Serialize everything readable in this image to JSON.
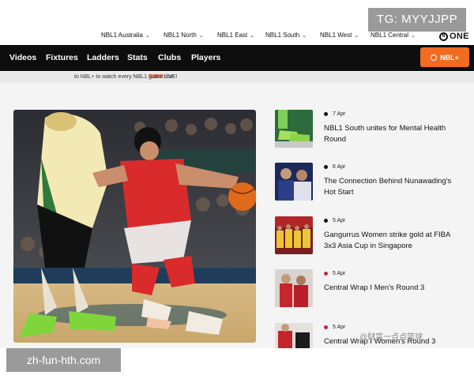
{
  "watermarks": {
    "top": "TG: MYYJJPP",
    "bottom": "zh-fun-hth.com",
    "weibo": "@财富一点点篮球"
  },
  "league_nav": [
    {
      "label": "NBL1 Australia"
    },
    {
      "label": "NBL1 North"
    },
    {
      "label": "NBL1 East"
    },
    {
      "label": "NBL1 South"
    },
    {
      "label": "NBL1 West"
    },
    {
      "label": "NBL1 Central"
    }
  ],
  "brand": {
    "logo_text": "ONE",
    "logo_mark": "N"
  },
  "main_nav": [
    {
      "label": "Videos"
    },
    {
      "label": "Fixtures"
    },
    {
      "label": "Ladders"
    },
    {
      "label": "Stats"
    },
    {
      "label": "Clubs"
    },
    {
      "label": "Players"
    }
  ],
  "nbl_plus_button": "NBL+",
  "subscribe": {
    "prefix": "Subscribe for ",
    "free": "FREE",
    "suffix": " to NBL+ to watch every NBL1 game LIVE!"
  },
  "news": [
    {
      "date": "7 Apr",
      "title": "NBL1 South unites for Mental Health Round",
      "dot": "black",
      "thumb": "shoes-icon"
    },
    {
      "date": "6 Apr",
      "title": "The Connection Behind Nunawading's Hot Start",
      "dot": "black",
      "thumb": "players-photo"
    },
    {
      "date": "5 Apr",
      "title": "Gangurrus Women strike gold at FIBA 3x3 Asia Cup in Singapore",
      "dot": "black",
      "thumb": "team-photo"
    },
    {
      "date": "5 Apr",
      "title": "Central Wrap I Men's Round 3",
      "dot": "red",
      "thumb": "mens-photo"
    },
    {
      "date": "5 Apr",
      "title": "Central Wrap I Women's Round 3",
      "dot": "red",
      "thumb": "womens-photo"
    }
  ],
  "colors": {
    "accent": "#f26b21",
    "nav_bg": "#0d0d0d",
    "red_dot": "#c0283a"
  }
}
